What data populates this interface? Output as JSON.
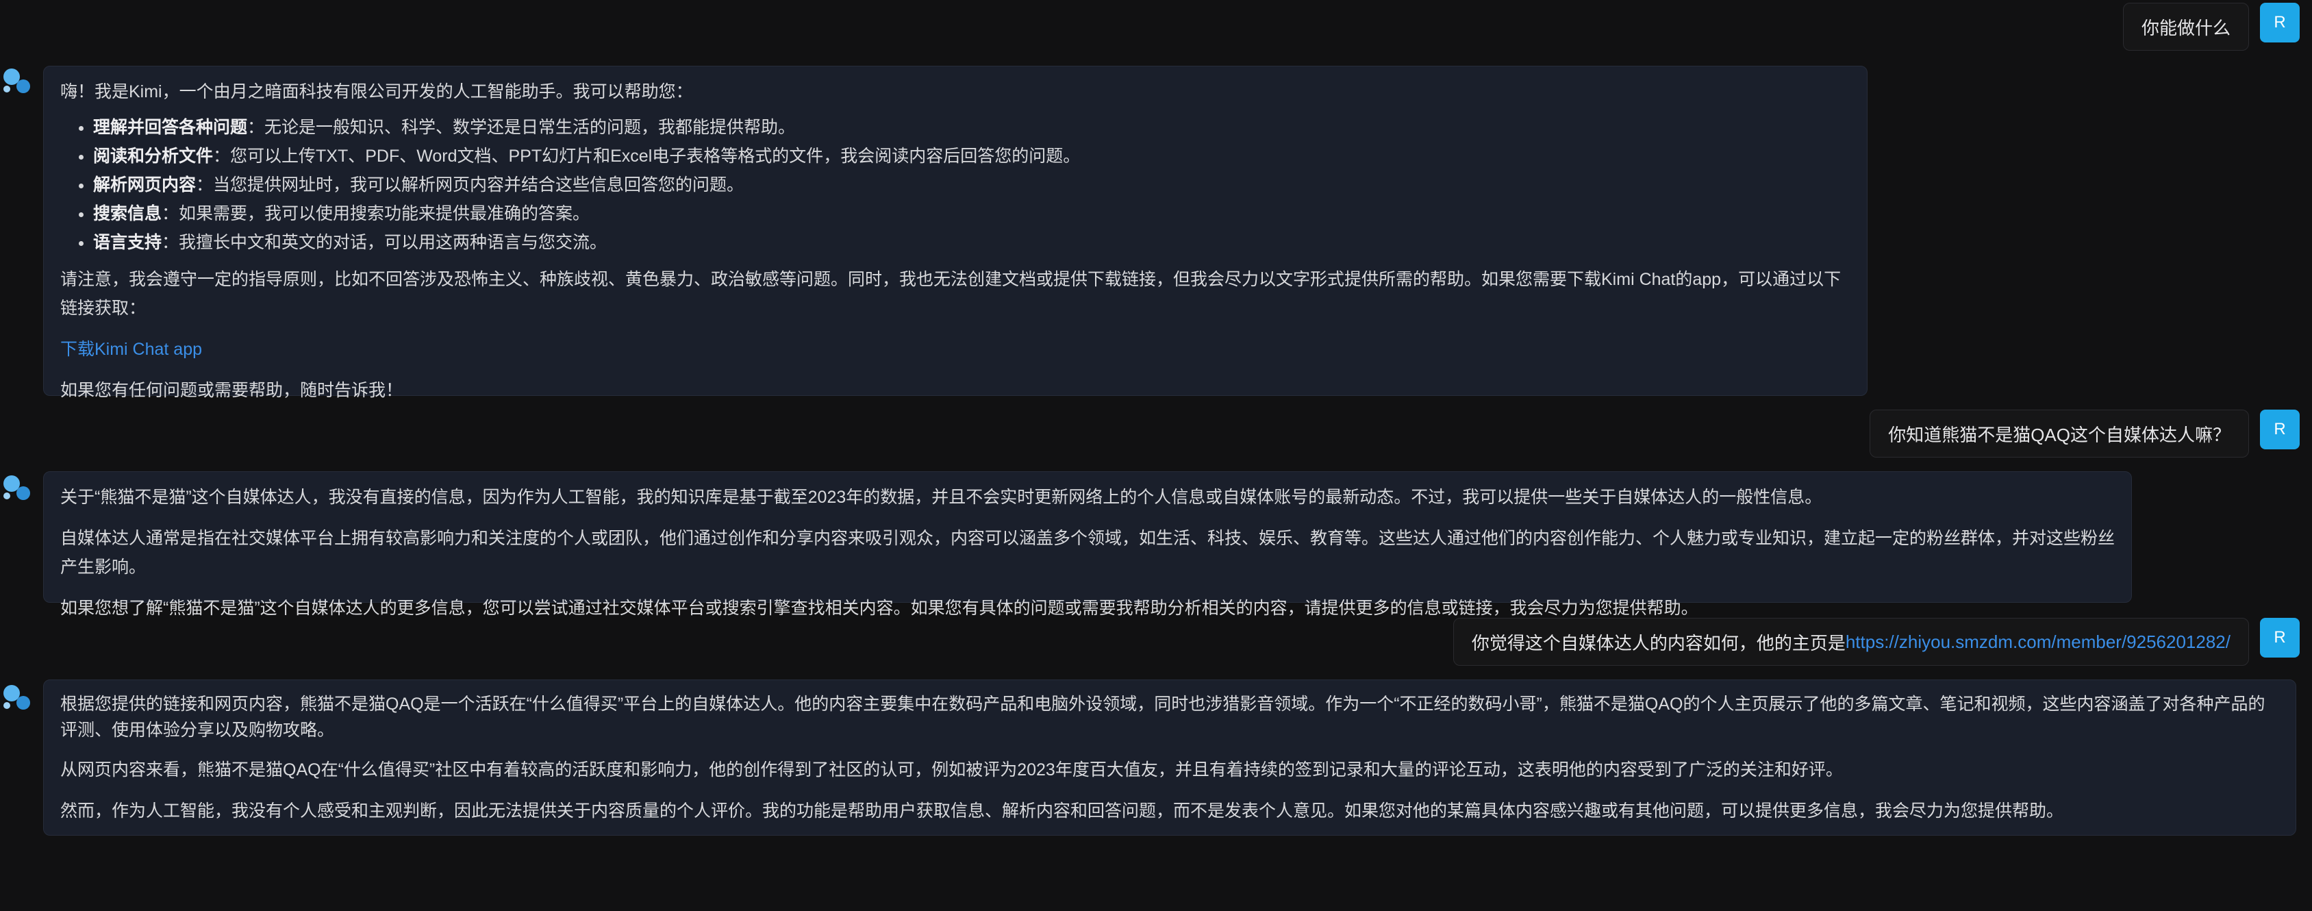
{
  "user_avatar_letter": "R",
  "messages": [
    {
      "role": "user",
      "text": "你能做什么"
    },
    {
      "role": "assistant",
      "intro": "嗨！我是Kimi，一个由月之暗面科技有限公司开发的人工智能助手。我可以帮助您：",
      "bullets": [
        {
          "title": "理解并回答各种问题",
          "text": "：无论是一般知识、科学、数学还是日常生活的问题，我都能提供帮助。"
        },
        {
          "title": "阅读和分析文件",
          "text": "：您可以上传TXT、PDF、Word文档、PPT幻灯片和Excel电子表格等格式的文件，我会阅读内容后回答您的问题。"
        },
        {
          "title": "解析网页内容",
          "text": "：当您提供网址时，我可以解析网页内容并结合这些信息回答您的问题。"
        },
        {
          "title": "搜索信息",
          "text": "：如果需要，我可以使用搜索功能来提供最准确的答案。"
        },
        {
          "title": "语言支持",
          "text": "：我擅长中文和英文的对话，可以用这两种语言与您交流。"
        }
      ],
      "note": "请注意，我会遵守一定的指导原则，比如不回答涉及恐怖主义、种族歧视、黄色暴力、政治敏感等问题。同时，我也无法创建文档或提供下载链接，但我会尽力以文字形式提供所需的帮助。如果您需要下载Kimi Chat的app，可以通过以下链接获取：",
      "link": "下载Kimi Chat app",
      "closing": "如果您有任何问题或需要帮助，随时告诉我！"
    },
    {
      "role": "user",
      "text": "你知道熊猫不是猫QAQ这个自媒体达人嘛？"
    },
    {
      "role": "assistant",
      "paragraphs": [
        "关于“熊猫不是猫”这个自媒体达人，我没有直接的信息，因为作为人工智能，我的知识库是基于截至2023年的数据，并且不会实时更新网络上的个人信息或自媒体账号的最新动态。不过，我可以提供一些关于自媒体达人的一般性信息。",
        "自媒体达人通常是指在社交媒体平台上拥有较高影响力和关注度的个人或团队，他们通过创作和分享内容来吸引观众，内容可以涵盖多个领域，如生活、科技、娱乐、教育等。这些达人通过他们的内容创作能力、个人魅力或专业知识，建立起一定的粉丝群体，并对这些粉丝产生影响。",
        "如果您想了解“熊猫不是猫”这个自媒体达人的更多信息，您可以尝试通过社交媒体平台或搜索引擎查找相关内容。如果您有具体的问题或需要我帮助分析相关的内容，请提供更多的信息或链接，我会尽力为您提供帮助。"
      ]
    },
    {
      "role": "user",
      "text": "你觉得这个自媒体达人的内容如何，他的主页是",
      "link": "https://zhiyou.smzdm.com/member/9256201282/"
    },
    {
      "role": "assistant",
      "paragraphs": [
        "根据您提供的链接和网页内容，熊猫不是猫QAQ是一个活跃在“什么值得买”平台上的自媒体达人。他的内容主要集中在数码产品和电脑外设领域，同时也涉猎影音领域。作为一个“不正经的数码小哥”，熊猫不是猫QAQ的个人主页展示了他的多篇文章、笔记和视频，这些内容涵盖了对各种产品的评测、使用体验分享以及购物攻略。",
        "从网页内容来看，熊猫不是猫QAQ在“什么值得买”社区中有着较高的活跃度和影响力，他的创作得到了社区的认可，例如被评为2023年度百大值友，并且有着持续的签到记录和大量的评论互动，这表明他的内容受到了广泛的关注和好评。",
        "然而，作为人工智能，我没有个人感受和主观判断，因此无法提供关于内容质量的个人评价。我的功能是帮助用户获取信息、解析内容和回答问题，而不是发表个人意见。如果您对他的某篇具体内容感兴趣或有其他问题，可以提供更多信息，我会尽力为您提供帮助。"
      ]
    }
  ]
}
